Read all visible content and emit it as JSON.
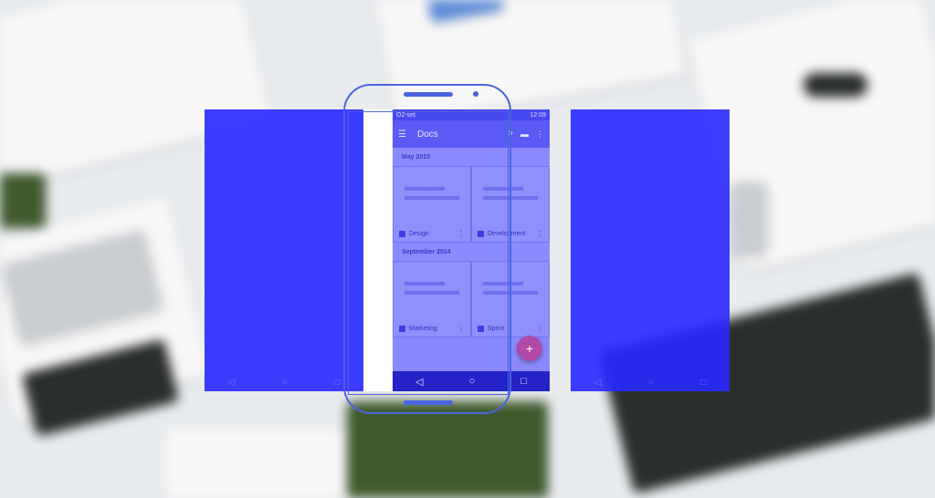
{
  "status": {
    "carrier": "O2-set",
    "time": "12:09"
  },
  "toolbar": {
    "title": "Docs",
    "search_icon": "search-icon",
    "folder_icon": "folder-icon",
    "more_icon": "more-vert-icon"
  },
  "sections": [
    {
      "header": "May 2015",
      "tiles": [
        {
          "label": "Design"
        },
        {
          "label": "Development"
        }
      ]
    },
    {
      "header": "September 2014",
      "tiles": [
        {
          "label": "Marketing"
        },
        {
          "label": "Sprint"
        }
      ]
    }
  ],
  "fab": {
    "label": "+"
  },
  "nav": {
    "back": "◁",
    "home": "○",
    "recents": "□"
  },
  "colors": {
    "overlay": "#2828ff",
    "fab": "#b04aa6",
    "outline": "#4a64e0"
  }
}
